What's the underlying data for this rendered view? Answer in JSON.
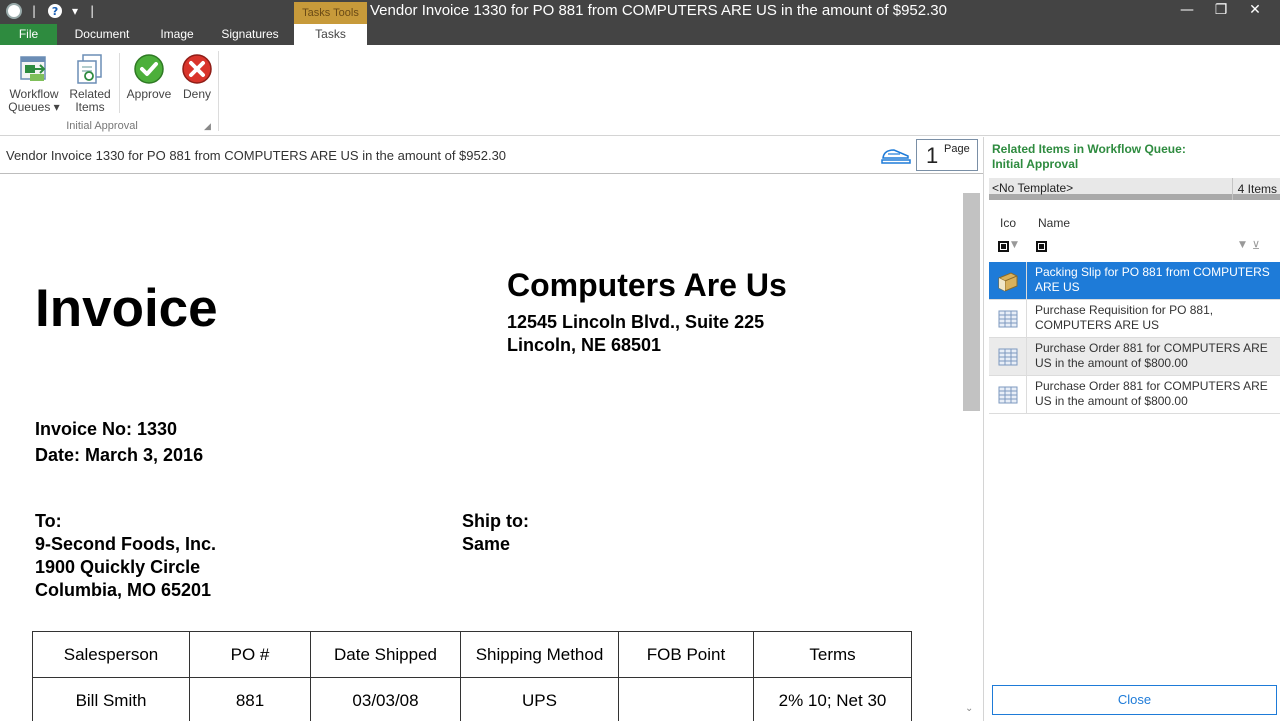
{
  "window": {
    "title": "Vendor Invoice 1330 for PO 881 from COMPUTERS ARE US in the amount of $952.30",
    "contextual_tab_group": "Tasks Tools",
    "controls": {
      "minimize": "—",
      "restore": "❐",
      "close": "✕"
    }
  },
  "quick_access": {
    "help": "?",
    "dropdown": "▾",
    "separator": "|"
  },
  "tabs": [
    {
      "label": "File"
    },
    {
      "label": "Document"
    },
    {
      "label": "Image"
    },
    {
      "label": "Signatures"
    },
    {
      "label": "Tasks"
    }
  ],
  "ribbon": {
    "workflow_queues": {
      "line1": "Workflow",
      "line2": "Queues ▾"
    },
    "related_items": {
      "line1": "Related",
      "line2": "Items"
    },
    "approve": "Approve",
    "deny": "Deny",
    "group_label": "Initial Approval",
    "launcher": "◢"
  },
  "document_header": {
    "title": "Vendor Invoice 1330 for PO 881 from COMPUTERS ARE US in the amount of $952.30",
    "page_number": "1",
    "page_label": "Page"
  },
  "invoice": {
    "heading": "Invoice",
    "company": "Computers Are Us",
    "address_line1": "12545 Lincoln Blvd., Suite 225",
    "address_line2": "Lincoln, NE 68501",
    "invoice_no": "Invoice No: 1330",
    "date": "Date: March 3, 2016",
    "to_label": "To:",
    "to_line1": "9-Second Foods, Inc.",
    "to_line2": "1900 Quickly Circle",
    "to_line3": "Columbia, MO 65201",
    "ship_to_label": "Ship to:",
    "ship_to_value": "Same",
    "table_headers": [
      "Salesperson",
      "PO #",
      "Date Shipped",
      "Shipping Method",
      "FOB Point",
      "Terms"
    ],
    "table_row": [
      "Bill Smith",
      "881",
      "03/03/08",
      "UPS",
      "",
      "2% 10; Net 30"
    ]
  },
  "related_panel": {
    "title_line1": "Related Items in Workflow Queue:",
    "title_line2": "Initial Approval",
    "template": "<No Template>",
    "count": "4 Items",
    "col_icon": "Ico",
    "col_name": "Name",
    "items": [
      {
        "name": "Packing Slip for PO 881 from COMPUTERS ARE US"
      },
      {
        "name": "Purchase Requisition for PO 881, COMPUTERS ARE US"
      },
      {
        "name": "Purchase Order 881 for COMPUTERS ARE US in the amount of $800.00"
      },
      {
        "name": "Purchase Order 881 for COMPUTERS ARE US in the amount of $800.00"
      }
    ],
    "close_label": "Close"
  },
  "colors": {
    "titlebar": "#444444",
    "file_tab": "#2e8b3f",
    "contextual_tab": "#c79a3a",
    "accent_green": "#2e8b3f",
    "selection_blue": "#1e7bd8"
  }
}
